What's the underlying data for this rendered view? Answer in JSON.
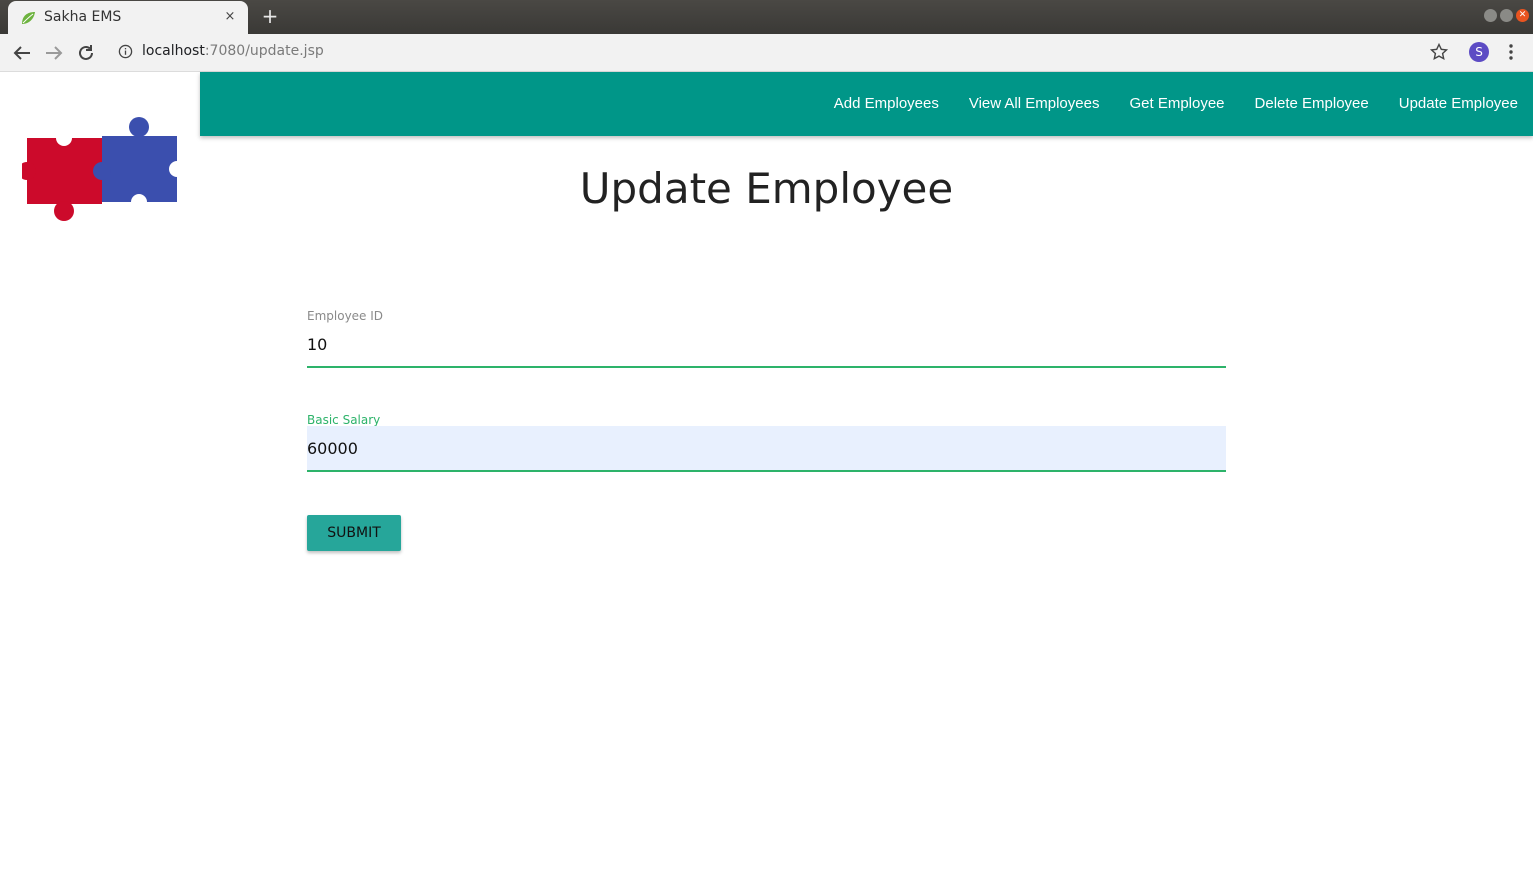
{
  "browser": {
    "tab_title": "Sakha EMS",
    "tab_close": "×",
    "new_tab": "+",
    "url_host": "localhost",
    "url_path": ":7080/update.jsp",
    "avatar_letter": "S"
  },
  "icons": {
    "favicon": "leaf-icon",
    "back": "arrow-left-icon",
    "forward": "arrow-right-icon",
    "reload": "reload-icon",
    "site_info": "info-icon",
    "bookmark": "star-icon",
    "menu": "kebab-menu-icon",
    "logo": "puzzle-logo"
  },
  "colors": {
    "navbar": "#009688",
    "accent": "#26a69a",
    "focus": "#2db36a",
    "autofill": "#e8f0fe",
    "logo_red": "#cc0a2b",
    "logo_blue": "#3b4fae"
  },
  "nav": {
    "items": [
      {
        "label": "Add Employees"
      },
      {
        "label": "View All Employees"
      },
      {
        "label": "Get Employee"
      },
      {
        "label": "Delete Employee"
      },
      {
        "label": "Update Employee"
      }
    ]
  },
  "main": {
    "title": "Update Employee",
    "form": {
      "employee_id": {
        "label": "Employee ID",
        "value": "10"
      },
      "basic_salary": {
        "label": "Basic Salary",
        "value": "60000"
      },
      "submit_label": "SUBMIT"
    }
  }
}
